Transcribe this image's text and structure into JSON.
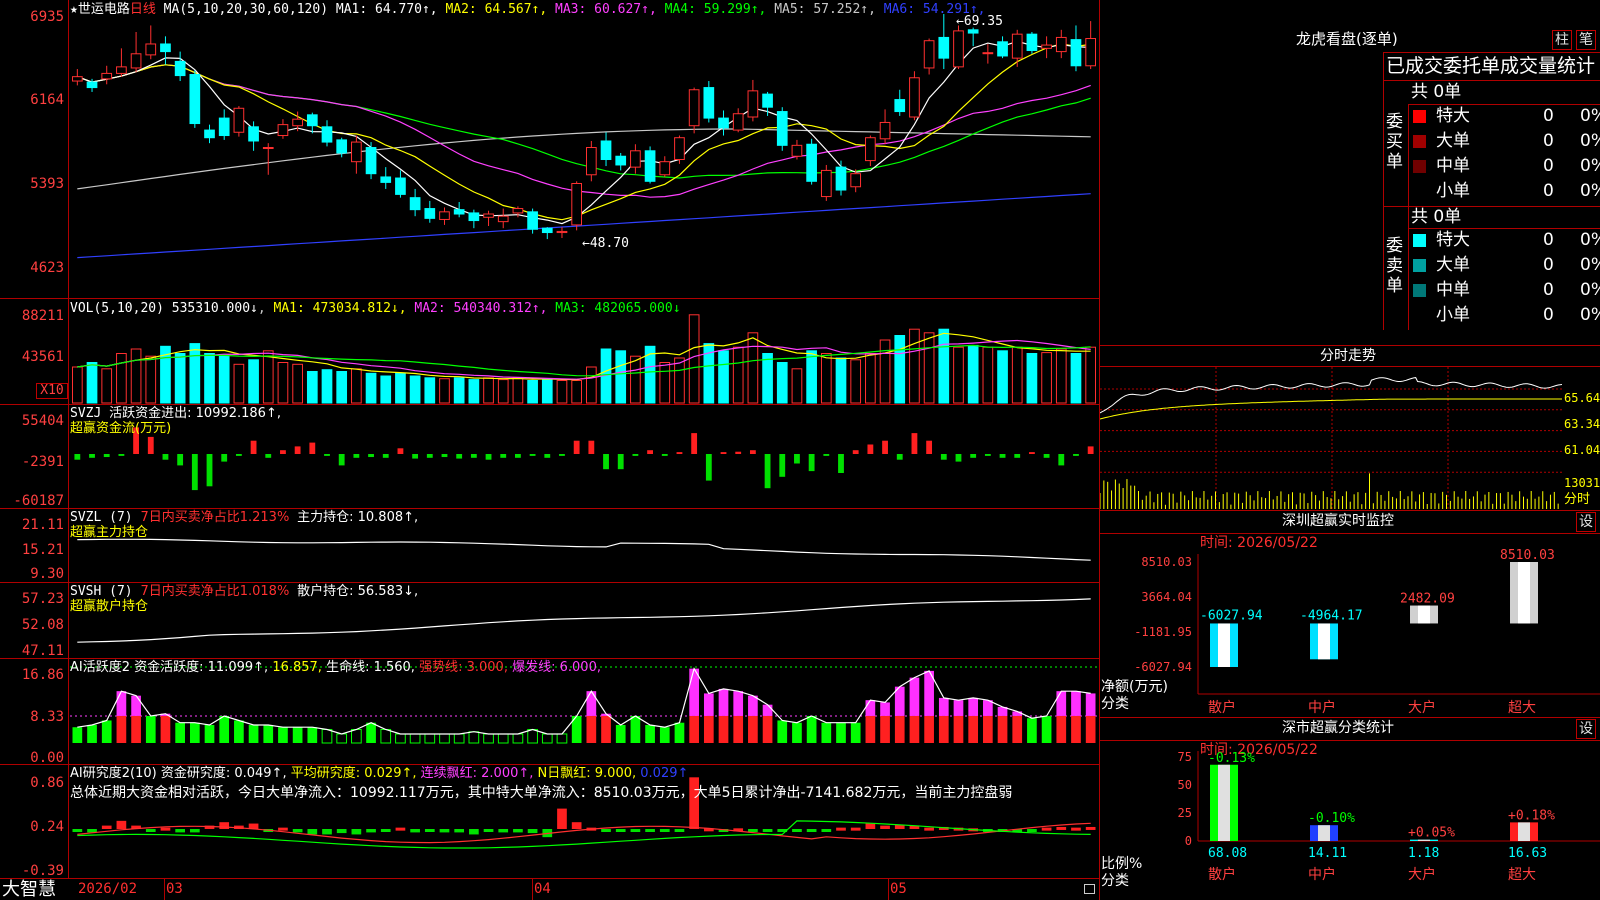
{
  "header": {
    "title": "★世运电路",
    "period": "日线",
    "ma_label": "MA(5,10,20,30,60,120)",
    "ma": [
      {
        "name": "MA1",
        "value": "64.770↑",
        "color": "#ffffff"
      },
      {
        "name": "MA2",
        "value": "64.567↑",
        "color": "#ffff00"
      },
      {
        "name": "MA3",
        "value": "60.627↑",
        "color": "#ff40ff"
      },
      {
        "name": "MA4",
        "value": "59.299↑",
        "color": "#00ff00"
      },
      {
        "name": "MA5",
        "value": "57.252↑",
        "color": "#c8c8c8"
      },
      {
        "name": "MA6",
        "value": "54.291↑",
        "color": "#3040ff"
      }
    ]
  },
  "price_axis": [
    "6935",
    "6164",
    "5393",
    "4623"
  ],
  "price_annotations": {
    "high": "69.35",
    "low": "48.70"
  },
  "vol": {
    "axis": [
      "88211",
      "43561"
    ],
    "multiplier": "X10",
    "label": "VOL(5,10,20)",
    "value": "535310.000↓",
    "ma": [
      {
        "name": "MA1",
        "value": "473034.812↓"
      },
      {
        "name": "MA2",
        "value": "540340.312↑"
      },
      {
        "name": "MA3",
        "value": "482065.000↓"
      }
    ]
  },
  "svzj": {
    "axis": [
      "55404",
      "-2391",
      "-60187"
    ],
    "label": "SVZJ",
    "line1": "活跃资金进出: 10992.186↑,",
    "line2": "超赢资金流(万元)"
  },
  "svzl": {
    "axis": [
      "21.11",
      "15.21",
      "9.30"
    ],
    "label": "SVZL (7)",
    "ratio": "7日内买卖净占比1.213%",
    "hold": "主力持仓: 10.808↑,",
    "line2": "超赢主力持仓"
  },
  "svsh": {
    "axis": [
      "57.23",
      "52.08",
      "47.11"
    ],
    "label": "SVSH (7)",
    "ratio": "7日内买卖净占比1.018%",
    "hold": "散户持仓: 56.583↓,",
    "line2": "超赢散户持仓"
  },
  "ai1": {
    "axis": [
      "16.86",
      "8.33",
      "0.00"
    ],
    "label": "AI活跃度2",
    "active": "资金活跃度: 11.099↑,",
    "v2": "16.857,",
    "life": "生命线: 1.560,",
    "strong": "强势线: 3.000,",
    "burst": "爆发线: 6.000,"
  },
  "ai2": {
    "axis": [
      "0.86",
      "0.24",
      "-0.39"
    ],
    "label": "AI研究度2(10)",
    "research": "资金研究度: 0.049↑,",
    "avg": "平均研究度: 0.029↑,",
    "streak": "连续飘红: 2.000↑,",
    "nday": "N日飘红: 9.000,",
    "last": "0.029↑",
    "summary": "总体近期大资金相对活跃，今日大单净流入：10992.117万元，其中特大单净流入：8510.03万元，大单5日累计净出-7141.682万元，当前主力控盘弱"
  },
  "footer": {
    "brand": "大智慧",
    "months": [
      "2026/02",
      "03",
      "04",
      "05"
    ]
  },
  "dragon": {
    "title": "龙虎看盘(逐单)",
    "btn1": "柱",
    "btn2": "笔",
    "tabs": "已成交委托单成交量统计",
    "buy_label": "委买单",
    "sell_label": "委卖单",
    "buy_total": "共 0单",
    "sell_total": "共 0单",
    "buy_rows": [
      {
        "name": "特大",
        "num": "0",
        "pct": "0%",
        "color": "#ff0000"
      },
      {
        "name": "大单",
        "num": "0",
        "pct": "0%",
        "color": "#a00000"
      },
      {
        "name": "中单",
        "num": "0",
        "pct": "0%",
        "color": "#700000"
      },
      {
        "name": "小单",
        "num": "0",
        "pct": "0%",
        "color": "#000000"
      }
    ],
    "sell_rows": [
      {
        "name": "特大",
        "num": "0",
        "pct": "0%",
        "color": "#00ffff"
      },
      {
        "name": "大单",
        "num": "0",
        "pct": "0%",
        "color": "#00a0a0"
      },
      {
        "name": "中单",
        "num": "0",
        "pct": "0%",
        "color": "#007878"
      },
      {
        "name": "小单",
        "num": "0",
        "pct": "0%",
        "color": "#000000"
      }
    ]
  },
  "intraday": {
    "title": "分时走势",
    "axis": [
      "65.64",
      "63.34",
      "61.04"
    ],
    "vol_axis": "13031",
    "vol_label": "分时"
  },
  "monitor": {
    "title": "深圳超赢实时监控",
    "btn": "设",
    "time": "时间: 2026/05/22",
    "axis": [
      "8510.03",
      "3664.04",
      "-1181.95",
      "-6027.94"
    ],
    "ylabel1": "净额(万元)",
    "ylabel2": "分类",
    "bars": [
      {
        "cat": "散户",
        "value": -6027.94,
        "label": "-6027.94"
      },
      {
        "cat": "中户",
        "value": -4964.17,
        "label": "-4964.17"
      },
      {
        "cat": "大户",
        "value": 2482.09,
        "label": "2482.09"
      },
      {
        "cat": "超大",
        "value": 8510.03,
        "label": "8510.03"
      }
    ]
  },
  "classify": {
    "title": "深市超赢分类统计",
    "btn": "设",
    "time": "时间: 2026/05/22",
    "axis": [
      "75",
      "50",
      "25",
      "0"
    ],
    "ylabel1": "比例%",
    "ylabel2": "分类",
    "bars": [
      {
        "cat": "散户",
        "value": 68.08,
        "change": "-0.13%",
        "label": "68.08"
      },
      {
        "cat": "中户",
        "value": 14.11,
        "change": "-0.10%",
        "label": "14.11"
      },
      {
        "cat": "大户",
        "value": 1.18,
        "change": "+0.05%",
        "label": "1.18"
      },
      {
        "cat": "超大",
        "value": 16.63,
        "change": "+0.18%",
        "label": "16.63"
      }
    ]
  },
  "chart_data": {
    "type": "candlestick",
    "ylim": [
      46.23,
      69.35
    ],
    "candles": [
      [
        63.2,
        63.6,
        64.3,
        62.8
      ],
      [
        63.1,
        62.6,
        63.4,
        62.2
      ],
      [
        63.4,
        63.9,
        64.6,
        62.9
      ],
      [
        63.9,
        64.5,
        66.2,
        63.6
      ],
      [
        64.4,
        65.7,
        67.7,
        64.0
      ],
      [
        65.6,
        66.6,
        68.3,
        65.2
      ],
      [
        66.6,
        65.9,
        67.3,
        64.7
      ],
      [
        65.0,
        63.7,
        65.9,
        63.2
      ],
      [
        63.8,
        59.3,
        64.2,
        58.9
      ],
      [
        58.7,
        58.0,
        59.2,
        57.5
      ],
      [
        59.8,
        58.2,
        60.6,
        57.8
      ],
      [
        58.5,
        60.7,
        60.9,
        58.1
      ],
      [
        59.0,
        57.7,
        59.5,
        56.8
      ],
      [
        57.1,
        57.1,
        57.5,
        54.6
      ],
      [
        58.2,
        59.2,
        59.7,
        57.9
      ],
      [
        59.1,
        59.7,
        60.4,
        58.6
      ],
      [
        60.1,
        59.1,
        60.3,
        58.4
      ],
      [
        59.0,
        57.6,
        59.6,
        57.2
      ],
      [
        57.8,
        56.6,
        58.0,
        56.2
      ],
      [
        55.8,
        57.6,
        58.2,
        54.7
      ],
      [
        57.1,
        54.7,
        57.6,
        54.2
      ],
      [
        54.4,
        53.9,
        55.3,
        53.3
      ],
      [
        54.3,
        52.8,
        55.0,
        52.5
      ],
      [
        52.5,
        51.4,
        53.3,
        50.8
      ],
      [
        51.5,
        50.6,
        52.2,
        50.2
      ],
      [
        50.5,
        51.2,
        51.6,
        50.0
      ],
      [
        51.4,
        51.0,
        52.1,
        50.7
      ],
      [
        51.1,
        50.4,
        51.4,
        49.7
      ],
      [
        50.7,
        51.0,
        51.3,
        49.9
      ],
      [
        50.3,
        50.8,
        51.5,
        49.7
      ],
      [
        51.1,
        51.5,
        51.7,
        50.7
      ],
      [
        51.2,
        49.6,
        51.5,
        49.2
      ],
      [
        49.7,
        49.3,
        49.8,
        48.7
      ],
      [
        49.3,
        49.4,
        49.8,
        48.8
      ],
      [
        50.0,
        53.8,
        54.0,
        49.5
      ],
      [
        54.6,
        57.1,
        57.7,
        54.0
      ],
      [
        57.7,
        56.0,
        58.5,
        55.4
      ],
      [
        56.3,
        55.5,
        56.6,
        55.0
      ],
      [
        55.3,
        56.8,
        57.4,
        54.7
      ],
      [
        56.8,
        54.0,
        57.2,
        53.8
      ],
      [
        54.6,
        55.8,
        56.3,
        54.4
      ],
      [
        56.0,
        58.0,
        58.2,
        55.6
      ],
      [
        59.1,
        62.4,
        62.6,
        58.4
      ],
      [
        62.6,
        59.8,
        63.2,
        59.4
      ],
      [
        59.8,
        58.9,
        60.5,
        58.2
      ],
      [
        58.7,
        60.2,
        60.7,
        58.5
      ],
      [
        59.9,
        62.3,
        63.3,
        59.5
      ],
      [
        62.0,
        60.8,
        62.2,
        60.0
      ],
      [
        60.4,
        57.3,
        60.8,
        56.8
      ],
      [
        56.3,
        57.3,
        57.8,
        56.0
      ],
      [
        57.4,
        54.0,
        57.9,
        53.7
      ],
      [
        52.6,
        55.0,
        55.5,
        52.2
      ],
      [
        55.3,
        53.2,
        55.9,
        52.7
      ],
      [
        53.5,
        54.7,
        55.1,
        53.0
      ],
      [
        55.9,
        58.0,
        58.2,
        55.4
      ],
      [
        57.9,
        59.4,
        60.6,
        57.4
      ],
      [
        61.5,
        60.4,
        62.4,
        60.0
      ],
      [
        59.9,
        63.5,
        64.1,
        59.6
      ],
      [
        64.4,
        66.9,
        67.1,
        63.8
      ],
      [
        67.2,
        65.3,
        69.35,
        64.3
      ],
      [
        64.5,
        67.8,
        68.3,
        64.3
      ],
      [
        67.9,
        67.6,
        68.1,
        66.4
      ],
      [
        65.8,
        65.8,
        66.6,
        64.8
      ],
      [
        66.8,
        65.5,
        67.3,
        65.3
      ],
      [
        65.3,
        67.5,
        67.9,
        64.5
      ],
      [
        67.5,
        66.0,
        67.7,
        65.7
      ],
      [
        66.2,
        66.5,
        67.3,
        65.3
      ],
      [
        65.9,
        67.2,
        67.9,
        65.3
      ],
      [
        67.0,
        64.6,
        68.3,
        64.1
      ],
      [
        64.6,
        67.1,
        68.7,
        64.3
      ]
    ],
    "volume": [
      0.4,
      0.45,
      0.38,
      0.55,
      0.6,
      0.52,
      0.63,
      0.55,
      0.66,
      0.55,
      0.53,
      0.43,
      0.48,
      0.58,
      0.45,
      0.43,
      0.35,
      0.37,
      0.35,
      0.38,
      0.33,
      0.3,
      0.33,
      0.3,
      0.28,
      0.27,
      0.28,
      0.26,
      0.28,
      0.26,
      0.28,
      0.25,
      0.27,
      0.25,
      0.25,
      0.4,
      0.6,
      0.58,
      0.52,
      0.63,
      0.45,
      0.5,
      0.98,
      0.66,
      0.58,
      0.62,
      0.78,
      0.55,
      0.45,
      0.38,
      0.58,
      0.55,
      0.5,
      0.48,
      0.55,
      0.7,
      0.75,
      0.82,
      0.78,
      0.82,
      0.62,
      0.64,
      0.62,
      0.58,
      0.62,
      0.55,
      0.56,
      0.6,
      0.55,
      0.62
    ],
    "flow": [
      -0.15,
      -0.1,
      -0.08,
      -0.05,
      0.7,
      0.45,
      -0.15,
      -0.3,
      -0.95,
      -0.85,
      -0.2,
      -0.05,
      0.35,
      -0.1,
      0.1,
      0.2,
      0.3,
      -0.05,
      -0.3,
      -0.1,
      -0.08,
      -0.1,
      0.15,
      -0.12,
      -0.1,
      -0.08,
      -0.12,
      -0.1,
      -0.15,
      -0.1,
      -0.1,
      -0.05,
      -0.1,
      -0.05,
      0.35,
      0.35,
      -0.4,
      -0.4,
      -0.05,
      0.1,
      -0.05,
      0.05,
      0.55,
      -0.7,
      0.05,
      0.06,
      0.1,
      -0.9,
      -0.6,
      -0.25,
      -0.45,
      -0.05,
      -0.5,
      0.1,
      0.25,
      0.35,
      -0.15,
      0.55,
      0.35,
      -0.15,
      -0.2,
      -0.1,
      -0.05,
      -0.1,
      -0.1,
      0.05,
      -0.1,
      -0.3,
      -0.05,
      0.2
    ],
    "activity": [
      3.5,
      4.0,
      5.0,
      11.5,
      10.5,
      6.0,
      6.5,
      4.5,
      4.5,
      4.0,
      6.0,
      5.0,
      4.0,
      4.0,
      3.5,
      3.5,
      3.5,
      3.0,
      2.0,
      3.0,
      4.5,
      3.0,
      2.0,
      2.0,
      2.0,
      2.0,
      2.0,
      2.5,
      2.0,
      2.0,
      2.0,
      3.0,
      2.0,
      2.0,
      6.0,
      11.5,
      6.5,
      4.0,
      6.0,
      4.0,
      3.5,
      4.5,
      16.5,
      11.0,
      12.0,
      11.5,
      10.5,
      8.5,
      5.0,
      4.5,
      6.0,
      4.5,
      4.5,
      4.5,
      9.5,
      9.0,
      12.5,
      14.5,
      16.0,
      10.0,
      9.5,
      10.0,
      9.5,
      8.0,
      7.0,
      5.5,
      6.0,
      11.5,
      11.5,
      11.0
    ],
    "research": [
      0.0,
      -0.05,
      0.05,
      0.12,
      0.05,
      -0.01,
      0.02,
      -0.05,
      -0.05,
      0.05,
      0.1,
      0.05,
      0.08,
      -0.04,
      0.02,
      -0.05,
      -0.08,
      -0.08,
      -0.06,
      -0.08,
      -0.05,
      -0.02,
      0.02,
      -0.05,
      0.0,
      -0.05,
      -0.05,
      -0.08,
      -0.02,
      -0.05,
      -0.05,
      -0.06,
      -0.12,
      0.3,
      0.1,
      0.02,
      -0.02,
      -0.01,
      0.0,
      -0.02,
      -0.02,
      0.0,
      0.76,
      0.01,
      -0.02,
      0.01,
      0.0,
      -0.01,
      -0.02,
      0.0,
      -0.03,
      -0.02,
      0.02,
      0.02,
      0.08,
      0.05,
      0.06,
      0.05,
      0.02,
      0.03,
      0.02,
      0.01,
      0.0,
      -0.02,
      -0.01,
      -0.02,
      0.02,
      0.03,
      0.02,
      0.03
    ]
  }
}
